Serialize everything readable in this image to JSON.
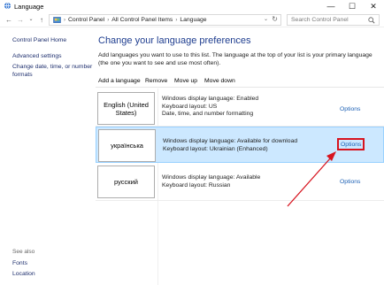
{
  "window": {
    "title": "Language",
    "icon": "globe-language-icon"
  },
  "window_controls": {
    "minimize": "—",
    "maximize": "☐",
    "close": "✕"
  },
  "nav": {
    "back": "←",
    "forward": "→",
    "up": "↑"
  },
  "address": {
    "crumbs": [
      "Control Panel",
      "All Control Panel Items",
      "Language"
    ],
    "separator": "›"
  },
  "search": {
    "placeholder": "Search Control Panel"
  },
  "sidebar": {
    "links": [
      "Control Panel Home",
      "Advanced settings",
      "Change date, time, or number formats"
    ],
    "see_also_title": "See also",
    "see_also_links": [
      "Fonts",
      "Location"
    ]
  },
  "main": {
    "title": "Change your language preferences",
    "description": "Add languages you want to use to this list. The language at the top of your list is your primary language (the one you want to see and use most often).",
    "toolbar": [
      "Add a language",
      "Remove",
      "Move up",
      "Move down"
    ],
    "languages": [
      {
        "name": "English (United States)",
        "details": [
          "Windows display language: Enabled",
          "Keyboard layout: US",
          "Date, time, and number formatting"
        ],
        "options": "Options",
        "selected": false
      },
      {
        "name": "українська",
        "details": [
          "Windows display language: Available for download",
          "Keyboard layout: Ukrainian (Enhanced)"
        ],
        "options": "Options",
        "selected": true
      },
      {
        "name": "русский",
        "details": [
          "Windows display language: Available",
          "Keyboard layout: Russian"
        ],
        "options": "Options",
        "selected": false
      }
    ]
  },
  "colors": {
    "accent_link": "#1a5fb4",
    "title_blue": "#1e3d8f",
    "selection_bg": "#cce8ff",
    "annotation_red": "#d7141f"
  }
}
